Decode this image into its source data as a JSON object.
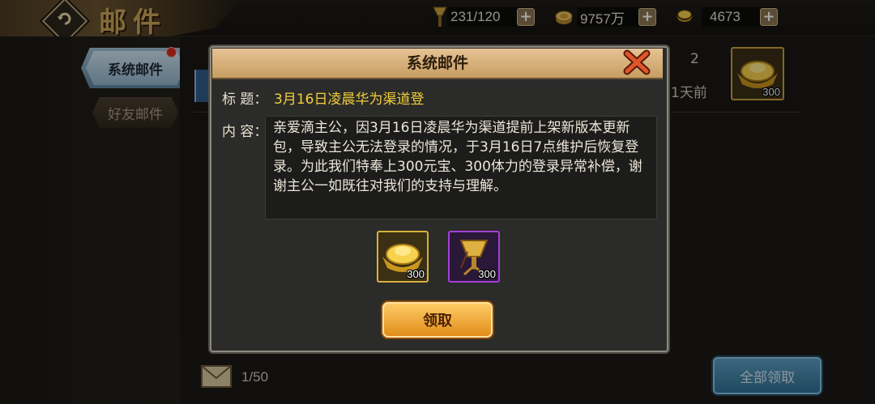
{
  "header": {
    "title": "邮件",
    "resources": [
      {
        "name": "stamina",
        "icon": "torch-icon",
        "value": "231/120"
      },
      {
        "name": "silver",
        "icon": "coin-icon",
        "value": "9757万"
      },
      {
        "name": "gold",
        "icon": "ingot-icon",
        "value": "4673"
      }
    ]
  },
  "sidebar": {
    "tabs": [
      {
        "label": "系统邮件",
        "active": true,
        "has_notification": true
      },
      {
        "label": "好友邮件",
        "active": false
      }
    ]
  },
  "mail_list": {
    "rows": [
      {
        "count": "2",
        "time": "1天前",
        "reward_qty": "300",
        "reward_icon": "gold-ingot-icon"
      }
    ]
  },
  "footer": {
    "page": "1/50",
    "claim_all_label": "全部领取"
  },
  "dialog": {
    "title": "系统邮件",
    "subject_label": "标 题：",
    "subject": "3月16日凌晨华为渠道登",
    "content_label": "内 容：",
    "content": "亲爱滴主公，因3月16日凌晨华为渠道提前上架新版本更新包，导致主公无法登录的情况，于3月16日7点维护后恢复登录。为此我们特奉上300元宝、300体力的登录异常补偿，谢谢主公一如既往对我们的支持与理解。",
    "rewards": [
      {
        "icon": "gold-ingot-icon",
        "qty": "300",
        "rarity_color": "#d7b23a"
      },
      {
        "icon": "bronze-cup-icon",
        "qty": "300",
        "rarity_color": "#a43fd8"
      }
    ],
    "claim_label": "领取"
  },
  "colors": {
    "accent_gold": "#f2cf3a",
    "dialog_header": "#c79d62",
    "claim_button": "#e08a16",
    "claim_all_button": "#2f6f92"
  }
}
